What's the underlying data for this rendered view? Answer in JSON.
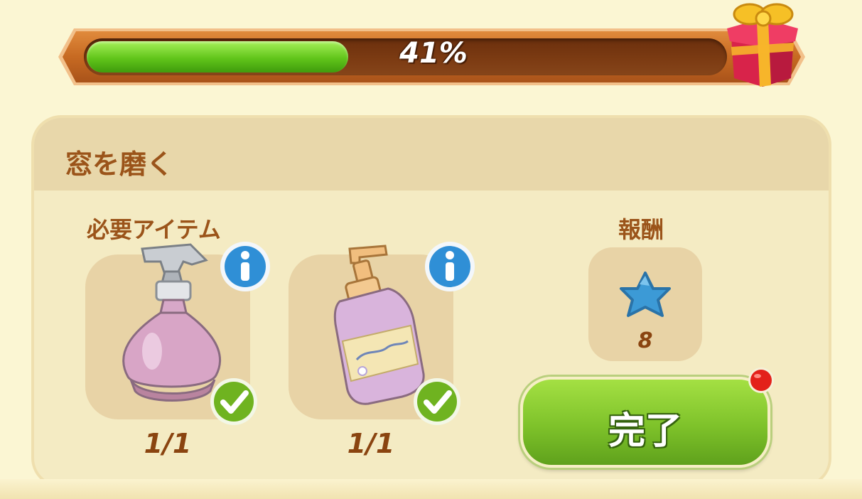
{
  "progress": {
    "percent_label": "41%",
    "fraction": 0.41
  },
  "task": {
    "title": "窓を磨く"
  },
  "required_items": {
    "label": "必要アイテム",
    "items": [
      {
        "name": "spray-bottle",
        "icon": "spray-bottle-icon",
        "count": "1/1",
        "complete": true
      },
      {
        "name": "soap-pump-bottle",
        "icon": "soap-bottle-icon",
        "count": "1/1",
        "complete": true
      }
    ]
  },
  "reward": {
    "label": "報酬",
    "icon": "blue-star-icon",
    "amount": "8"
  },
  "complete_button": {
    "label": "完了",
    "has_notification": true
  },
  "colors": {
    "accent_green": "#7ec22a",
    "progress_green": "#61c51a",
    "title_brown": "#9b541a",
    "panel": "#f4ebc3",
    "star_blue": "#3c9ad6",
    "notification_red": "#e3211a"
  }
}
